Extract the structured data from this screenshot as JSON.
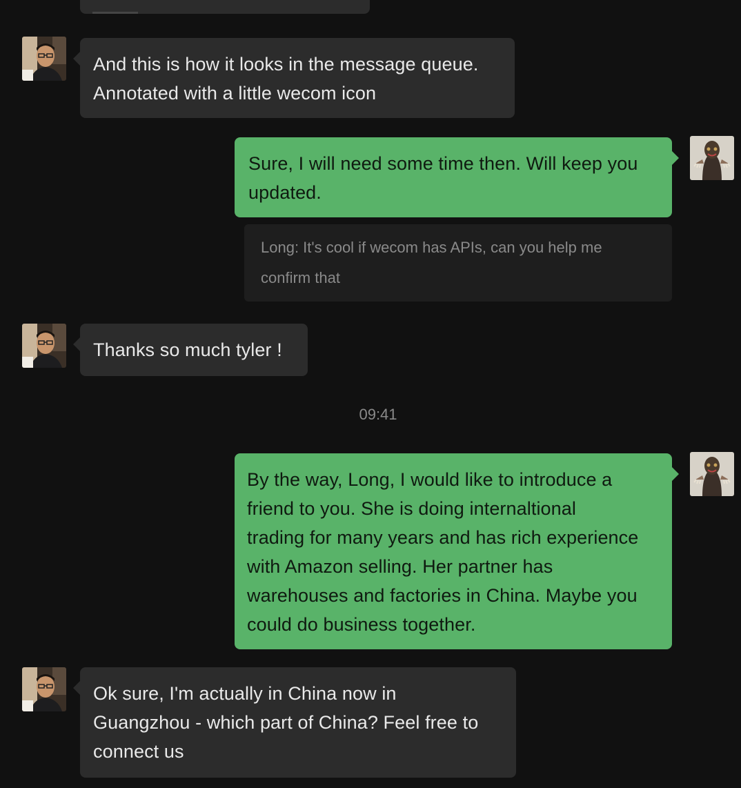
{
  "contacts": {
    "long": {
      "avatar_icon": "profile-photo-man-glasses-icon"
    },
    "me": {
      "avatar_icon": "profile-photo-mask-figure-icon"
    }
  },
  "colors": {
    "background": "#111111",
    "incoming_bubble": "#2c2c2c",
    "outgoing_bubble": "#59b369",
    "quote_block": "#1e1e1e",
    "timestamp_text": "#8a8a8a"
  },
  "messages": [
    {
      "sender": "long",
      "direction": "incoming",
      "text": "And this is how it looks in the message queue.\nAnnotated with a little wecom icon"
    },
    {
      "sender": "me",
      "direction": "outgoing",
      "text": "Sure, I will need some time then. Will keep you\nupdated."
    },
    {
      "sender": "me",
      "direction": "outgoing",
      "quote": "Long: It's cool if wecom has APIs, can you help me\nconfirm that"
    },
    {
      "sender": "long",
      "direction": "incoming",
      "text": "Thanks so much tyler !"
    },
    {
      "type": "timestamp",
      "text": "09:41"
    },
    {
      "sender": "me",
      "direction": "outgoing",
      "text": "By the way, Long, I would like to introduce a\nfriend to you. She is doing internaltional\ntrading for many years and has rich experience\nwith Amazon selling. Her partner has\nwarehouses and factories in China. Maybe you\ncould do business together."
    },
    {
      "sender": "long",
      "direction": "incoming",
      "text": "Ok sure, I'm actually in China now in\nGuangzhou - which part of China? Feel free to\nconnect us"
    }
  ]
}
